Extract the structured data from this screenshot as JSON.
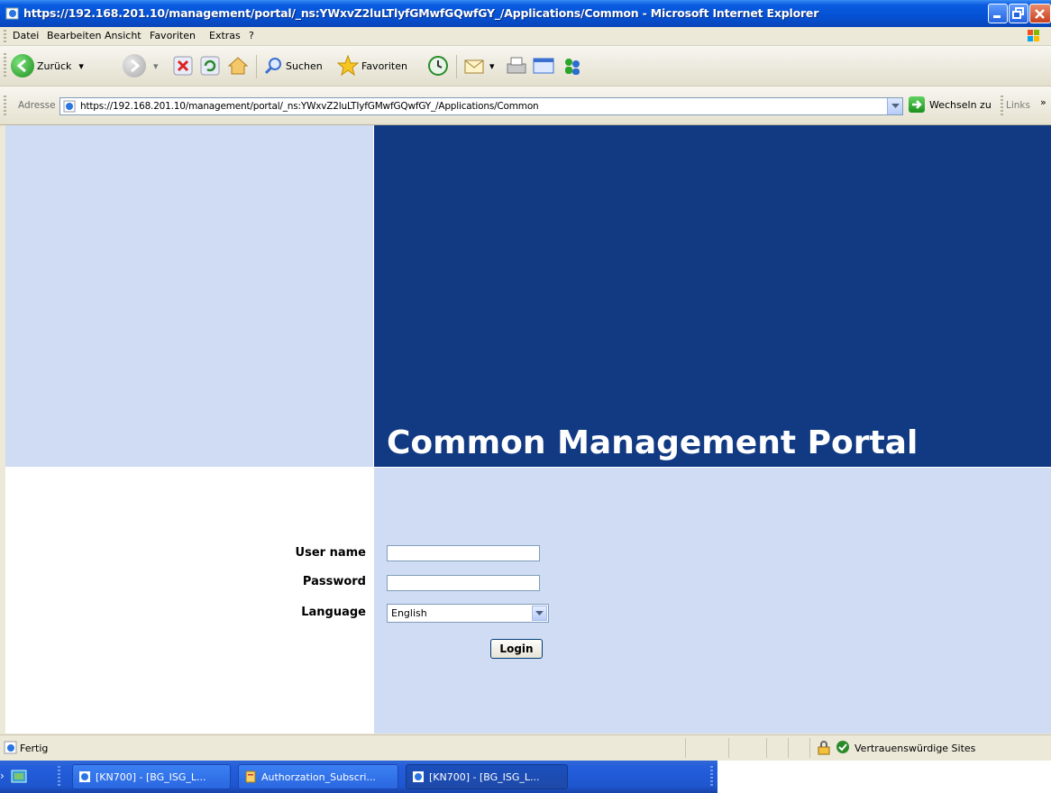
{
  "window": {
    "title": "https://192.168.201.10/management/portal/_ns:YWxvZ2luLTlyfGMwfGQwfGY_/Applications/Common - Microsoft Internet Explorer"
  },
  "menu": {
    "items": [
      "Datei",
      "Bearbeiten",
      "Ansicht",
      "Favoriten",
      "Extras",
      "?"
    ]
  },
  "toolbar": {
    "back_label": "Zurück",
    "search_label": "Suchen",
    "favorites_label": "Favoriten"
  },
  "address": {
    "label": "Adresse",
    "url": "https://192.168.201.10/management/portal/_ns:YWxvZ2luLTIyfGMwfGQwfGY_/Applications/Common",
    "go_label": "Wechseln zu",
    "links_label": "Links"
  },
  "portal": {
    "title": "Common Management Portal",
    "username_label": "User name",
    "password_label": "Password",
    "language_label": "Language",
    "username_value": "",
    "password_value": "",
    "language_value": "English",
    "login_label": "Login"
  },
  "status": {
    "text": "Fertig",
    "zone": "Vertrauenswürdige Sites"
  },
  "taskbar": {
    "buttons": [
      "[KN700] - [BG_ISG_L...",
      "Authorzation_Subscri...",
      "[KN700] - [BG_ISG_L..."
    ]
  },
  "colors": {
    "banner": "#123a82",
    "panel": "#d0dcf4",
    "titlebar": "#0551d4"
  }
}
